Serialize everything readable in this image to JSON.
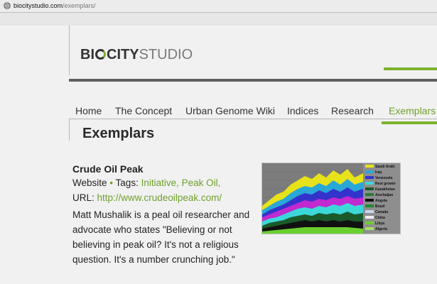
{
  "browser": {
    "url_host": "biocitystudio.com",
    "url_path": "/exemplars/"
  },
  "logo": {
    "part1": "BI",
    "part2": "CITY",
    "part3": "STUDIO"
  },
  "nav": {
    "items": [
      "Home",
      "The Concept",
      "Urban Genome Wiki",
      "Indices",
      "Research",
      "Exemplars"
    ],
    "active_index": 5
  },
  "page_title": "Exemplars",
  "entry": {
    "title": "Crude Oil Peak",
    "type_label": "Website",
    "bullet": "•",
    "tags_label": "Tags:",
    "tags": "Initiative, Peak Oil,",
    "url_label": "URL:",
    "url": "http://www.crudeoilpeak.com/",
    "description": "Matt Mushalik is a peal oil researcher and advocate who states \"Believing or not believing in peak oil? It's not a religious question. It's a number crunching job.\""
  },
  "chart_legend": [
    {
      "label": "Saudi Arabi",
      "color": "#e8e21a"
    },
    {
      "label": "Iraq",
      "color": "#29a8d8"
    },
    {
      "label": "Venezuela",
      "color": "#3333cc"
    },
    {
      "label": "Rest growin",
      "color": "#3cd8d8"
    },
    {
      "label": "Kazakhstan",
      "color": "#1a5a2a"
    },
    {
      "label": "Azerbaijan",
      "color": "#2a7a3a"
    },
    {
      "label": "Angola",
      "color": "#111111"
    },
    {
      "label": "Brazil",
      "color": "#1e8a2e"
    },
    {
      "label": "Canada",
      "color": "#c8d8f0"
    },
    {
      "label": "China",
      "color": "#eeeeee"
    },
    {
      "label": "Libya",
      "color": "#6ad030"
    },
    {
      "label": "Algeria",
      "color": "#a8e060"
    }
  ]
}
